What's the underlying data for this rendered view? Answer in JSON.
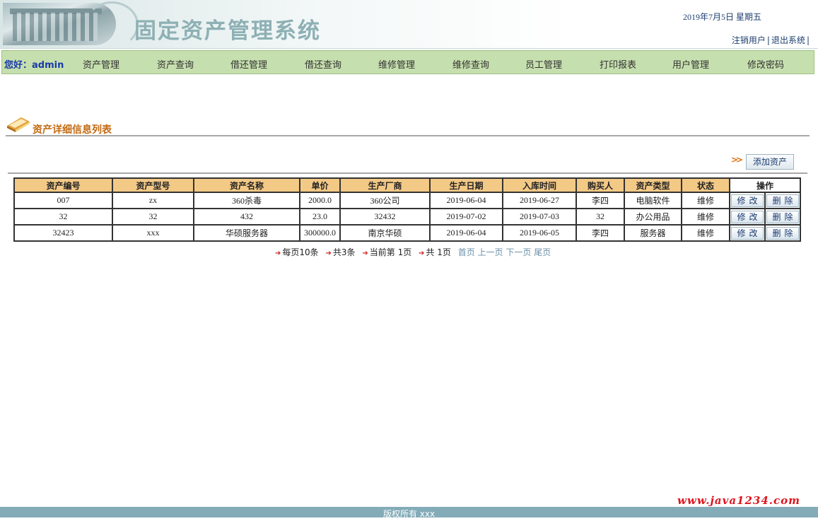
{
  "header": {
    "title": "固定资产管理系统",
    "date": "2019年7月5日   星期五",
    "links": [
      "注销用户",
      "退出系统"
    ]
  },
  "nav": {
    "greeting": "您好：admin",
    "items": [
      "资产管理",
      "资产查询",
      "借还管理",
      "借还查询",
      "维修管理",
      "维修查询",
      "员工管理",
      "打印报表",
      "用户管理",
      "修改密码"
    ]
  },
  "section": {
    "title": "资产详细信息列表",
    "add_button": "添加资产"
  },
  "table": {
    "headers": [
      "资产编号",
      "资产型号",
      "资产名称",
      "单价",
      "生产厂商",
      "生产日期",
      "入库时间",
      "购买人",
      "资产类型",
      "状态",
      "操作"
    ],
    "rows": [
      [
        "007",
        "zx",
        "360杀毒",
        "2000.0",
        "360公司",
        "2019-06-04",
        "2019-06-27",
        "李四",
        "电脑软件",
        "维修"
      ],
      [
        "32",
        "32",
        "432",
        "23.0",
        "32432",
        "2019-07-02",
        "2019-07-03",
        "32",
        "办公用品",
        "维修"
      ],
      [
        "32423",
        "xxx",
        "华硕服务器",
        "300000.0",
        "南京华硕",
        "2019-06-04",
        "2019-06-05",
        "李四",
        "服务器",
        "维修"
      ]
    ],
    "edit_label": "修改",
    "delete_label": "删除"
  },
  "pager": {
    "per_page": "每页10条",
    "total": "共3条",
    "current": "当前第 1页",
    "pages": "共 1页",
    "first": "首页",
    "prev": "上一页",
    "next": "下一页",
    "last": "尾页"
  },
  "footer": {
    "copyright": "版权所有 xxx",
    "watermark": "www.java1234.com"
  },
  "colors": {
    "nav_bg": "#c6dfae",
    "table_header_bg": "#f3c986",
    "section_title": "#c46a12",
    "footer_bg": "#83abb8",
    "watermark": "#e0141e"
  }
}
